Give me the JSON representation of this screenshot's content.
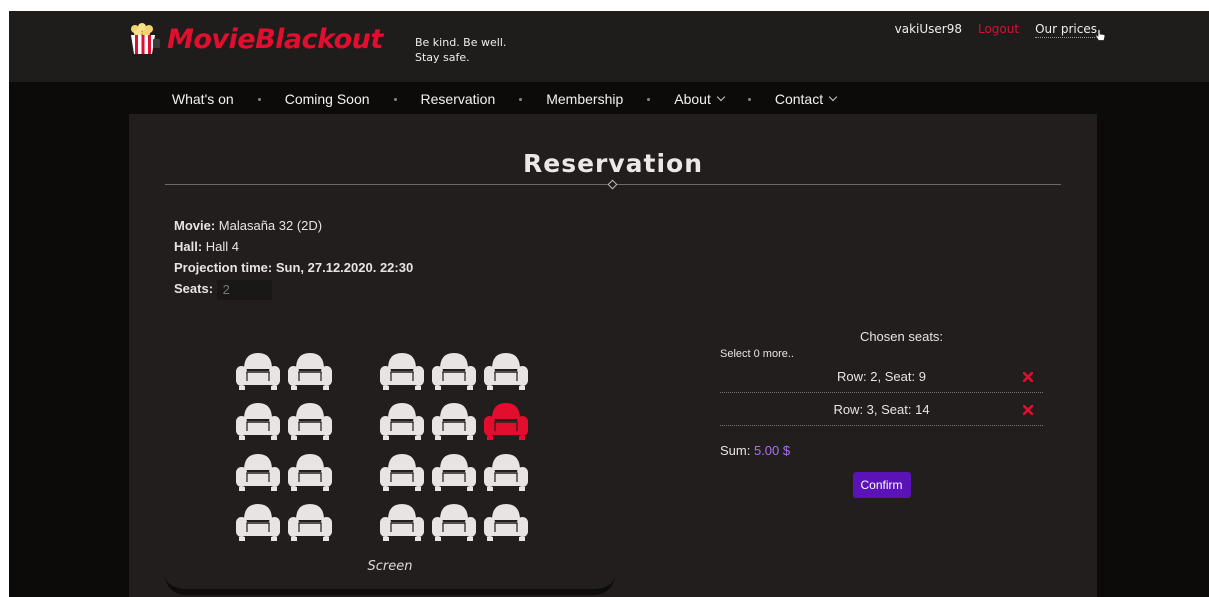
{
  "header": {
    "logo_text": "MovieBlackout",
    "slogan_line1": "Be kind. Be well.",
    "slogan_line2": "Stay safe.",
    "username": "vakiUser98",
    "logout_label": "Logout",
    "prices_label": "Our prices"
  },
  "nav": {
    "whats_on": "What's on",
    "coming_soon": "Coming Soon",
    "reservation": "Reservation",
    "membership": "Membership",
    "about": "About",
    "contact": "Contact"
  },
  "page": {
    "title": "Reservation"
  },
  "info": {
    "movie_label": "Movie:",
    "movie_value": "Malasaña 32 (2D)",
    "hall_label": "Hall:",
    "hall_value": "Hall 4",
    "time_label": "Projection time:",
    "time_value": "Sun, 27.12.2020. 22:30",
    "seats_label": "Seats:",
    "seats_value": "2"
  },
  "seatmap": {
    "screen_label": "Screen",
    "rows": 4,
    "left_block_cols": 2,
    "right_block_cols": 3,
    "selected": [
      {
        "row": 2,
        "col": 5
      }
    ],
    "colors": {
      "free": "#e8e4e4",
      "selected": "#e30e2e"
    }
  },
  "chosen": {
    "title": "Chosen seats:",
    "select_more": "Select 0 more..",
    "seats": [
      {
        "label": "Row: 2, Seat: 9"
      },
      {
        "label": "Row: 3, Seat: 14"
      }
    ],
    "sum_label": "Sum:",
    "sum_value": "5.00 $",
    "confirm_label": "Confirm"
  },
  "colors": {
    "accent_red": "#e30e2e",
    "accent_purple": "#5b12b7",
    "sum_purple": "#a970f5"
  }
}
